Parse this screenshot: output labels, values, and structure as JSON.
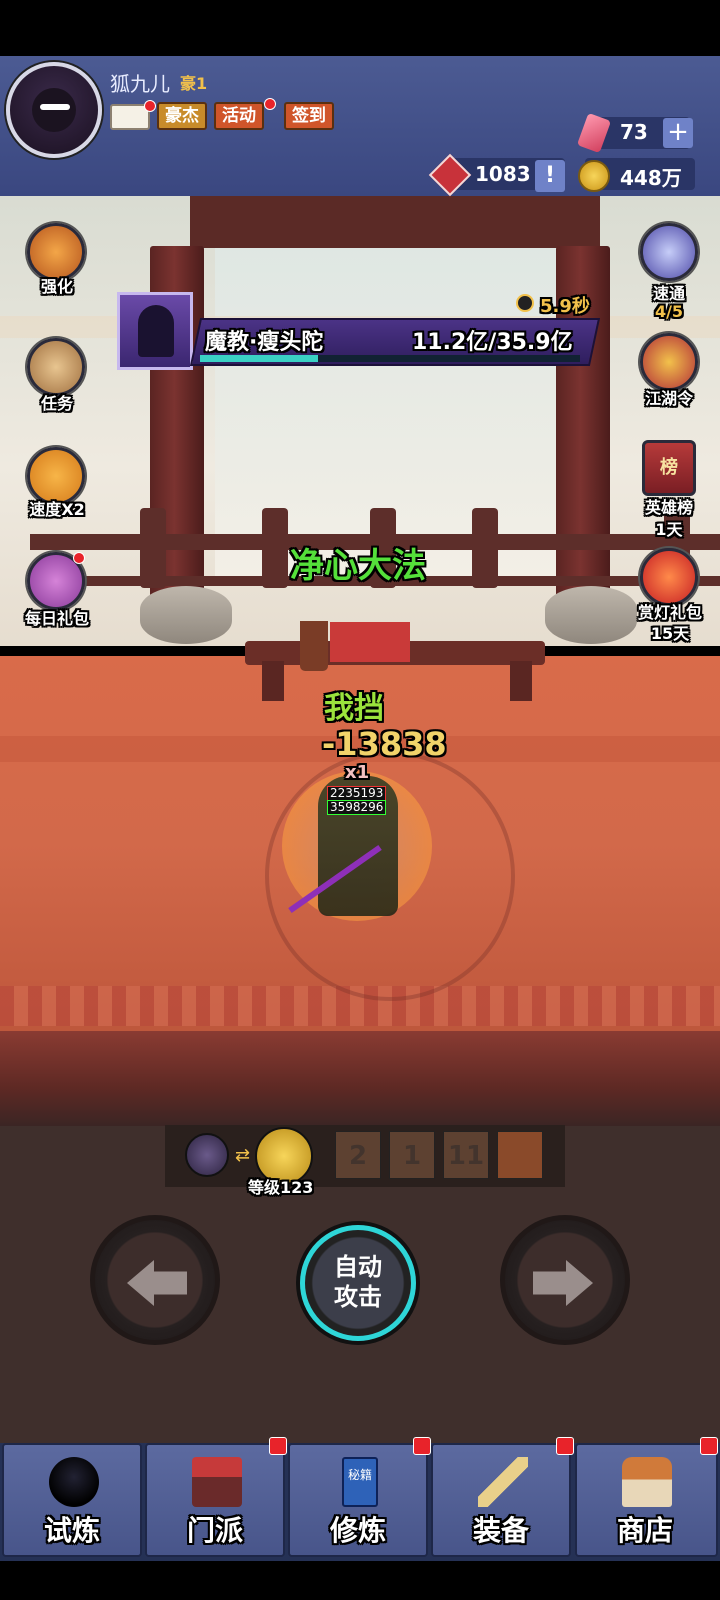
{
  "player": {
    "name": "狐九儿",
    "vip": "豪1",
    "avatar_icon": "ninja-avatar-icon"
  },
  "header": {
    "mail_icon": "mail-icon",
    "tabs": [
      {
        "label": "豪杰"
      },
      {
        "label": "活动"
      },
      {
        "label": "签到"
      }
    ]
  },
  "resources": {
    "gems": "73",
    "tickets": "1083",
    "coins": "448万"
  },
  "left_menu": [
    {
      "label": "强化",
      "icon": "octopus-icon"
    },
    {
      "label": "任务",
      "icon": "scroll-icon"
    },
    {
      "label": "速度X2",
      "icon": "fast-forward-icon"
    },
    {
      "label": "每日礼包",
      "icon": "gift-bag-icon"
    }
  ],
  "right_menu": [
    {
      "label": "速通",
      "sub": "4/5",
      "icon": "ghost-icon"
    },
    {
      "label": "江湖令",
      "sub": "",
      "icon": "token-icon"
    },
    {
      "label": "英雄榜",
      "sub": "1天",
      "icon": "leaderboard-banner-icon",
      "badge": "榜"
    },
    {
      "label": "赏灯礼包",
      "sub": "15天",
      "icon": "lantern-icon"
    }
  ],
  "boss": {
    "name": "魔教·瘦头陀",
    "hp_text": "11.2亿/35.9亿",
    "hp_fraction": 0.31,
    "timer": "5.9秒"
  },
  "battle": {
    "skill_name": "净心大法",
    "block_text": "我挡",
    "damage": "-13838",
    "combo": "x1",
    "hp_red": "2235193",
    "hp_green": "3598296"
  },
  "weapon_bar": {
    "level": "等级123",
    "slots": [
      "2",
      "1",
      "11"
    ]
  },
  "controls": {
    "auto_line1": "自动",
    "auto_line2": "攻击"
  },
  "nav": [
    {
      "label": "试炼",
      "icon": "ninja-icon",
      "dot": false
    },
    {
      "label": "门派",
      "icon": "temple-icon",
      "dot": true
    },
    {
      "label": "修炼",
      "icon": "book-icon",
      "dot": true,
      "badge": "秘籍"
    },
    {
      "label": "装备",
      "icon": "sword-icon",
      "dot": true
    },
    {
      "label": "商店",
      "icon": "shop-icon",
      "dot": true
    }
  ],
  "colors": {
    "accent_teal": "#2ed6d8",
    "skill_green": "#55e03a",
    "gold": "#f2c14b",
    "nav_blue": "#48558a"
  }
}
